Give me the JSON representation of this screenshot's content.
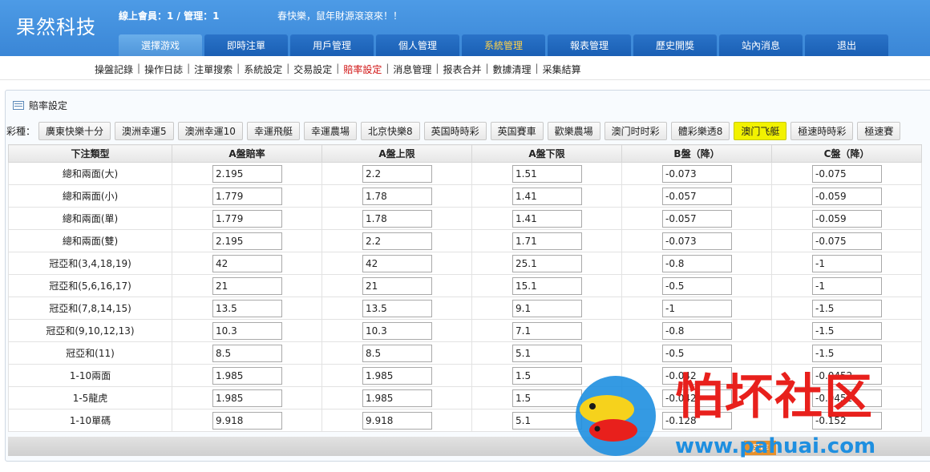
{
  "header": {
    "logo": "果然科技",
    "online": "線上會員：1 / 管理：1",
    "greeting": "春快樂，鼠年財源滾滾來！！"
  },
  "nav": [
    {
      "label": "選擇游戏",
      "state": "active"
    },
    {
      "label": "即時注單",
      "state": ""
    },
    {
      "label": "用戶管理",
      "state": ""
    },
    {
      "label": "個人管理",
      "state": ""
    },
    {
      "label": "系統管理",
      "state": "highlight"
    },
    {
      "label": "報表管理",
      "state": ""
    },
    {
      "label": "歷史開獎",
      "state": ""
    },
    {
      "label": "站內消息",
      "state": ""
    },
    {
      "label": "退出",
      "state": ""
    }
  ],
  "subnav": [
    {
      "label": "操盤記錄",
      "active": false
    },
    {
      "label": "操作日誌",
      "active": false
    },
    {
      "label": "注單搜索",
      "active": false
    },
    {
      "label": "系統設定",
      "active": false
    },
    {
      "label": "交易設定",
      "active": false
    },
    {
      "label": "賠率設定",
      "active": true
    },
    {
      "label": "消息管理",
      "active": false
    },
    {
      "label": "报表合并",
      "active": false
    },
    {
      "label": "數據清理",
      "active": false
    },
    {
      "label": "采集結算",
      "active": false
    }
  ],
  "panel": {
    "title": "賠率設定",
    "lottery_label": "彩種："
  },
  "lotteries": [
    {
      "label": "廣東快樂十分",
      "active": false
    },
    {
      "label": "澳洲幸運5",
      "active": false
    },
    {
      "label": "澳洲幸運10",
      "active": false
    },
    {
      "label": "幸運飛艇",
      "active": false
    },
    {
      "label": "幸運農場",
      "active": false
    },
    {
      "label": "北京快樂8",
      "active": false
    },
    {
      "label": "英国時時彩",
      "active": false
    },
    {
      "label": "英国賽車",
      "active": false
    },
    {
      "label": "歡樂農場",
      "active": false
    },
    {
      "label": "澳门时时彩",
      "active": false
    },
    {
      "label": "體彩樂透8",
      "active": false
    },
    {
      "label": "澳门飞艇",
      "active": true
    },
    {
      "label": "極速時時彩",
      "active": false
    },
    {
      "label": "極速賽",
      "active": false
    }
  ],
  "table": {
    "headers": [
      "下注類型",
      "A盤賠率",
      "A盤上限",
      "A盤下限",
      "B盤（降）",
      "C盤（降）"
    ],
    "rows": [
      [
        "總和兩面(大)",
        "2.195",
        "2.2",
        "1.51",
        "-0.073",
        "-0.075"
      ],
      [
        "總和兩面(小)",
        "1.779",
        "1.78",
        "1.41",
        "-0.057",
        "-0.059"
      ],
      [
        "總和兩面(單)",
        "1.779",
        "1.78",
        "1.41",
        "-0.057",
        "-0.059"
      ],
      [
        "總和兩面(雙)",
        "2.195",
        "2.2",
        "1.71",
        "-0.073",
        "-0.075"
      ],
      [
        "冠亞和(3,4,18,19)",
        "42",
        "42",
        "25.1",
        "-0.8",
        "-1"
      ],
      [
        "冠亞和(5,6,16,17)",
        "21",
        "21",
        "15.1",
        "-0.5",
        "-1"
      ],
      [
        "冠亞和(7,8,14,15)",
        "13.5",
        "13.5",
        "9.1",
        "-1",
        "-1.5"
      ],
      [
        "冠亞和(9,10,12,13)",
        "10.3",
        "10.3",
        "7.1",
        "-0.8",
        "-1.5"
      ],
      [
        "冠亞和(11)",
        "8.5",
        "8.5",
        "5.1",
        "-0.5",
        "-1.5"
      ],
      [
        "1-10兩面",
        "1.985",
        "1.985",
        "1.5",
        "-0.042",
        "-0.0452"
      ],
      [
        "1-5龍虎",
        "1.985",
        "1.985",
        "1.5",
        "-0.042",
        "-0.0452"
      ],
      [
        "1-10單碼",
        "9.918",
        "9.918",
        "5.1",
        "-0.128",
        "-0.152"
      ]
    ]
  },
  "save_label": "保存",
  "watermark": {
    "text": "怕坏社区",
    "url": "www.pahuai.com"
  },
  "colors": {
    "header_blue": "#3a86d6",
    "nav_blue": "#1a5fb4",
    "active_lottery": "#f2f200",
    "active_subnav": "#d01010",
    "watermark_red": "#e8201c",
    "watermark_blue": "#1e8fe0"
  }
}
